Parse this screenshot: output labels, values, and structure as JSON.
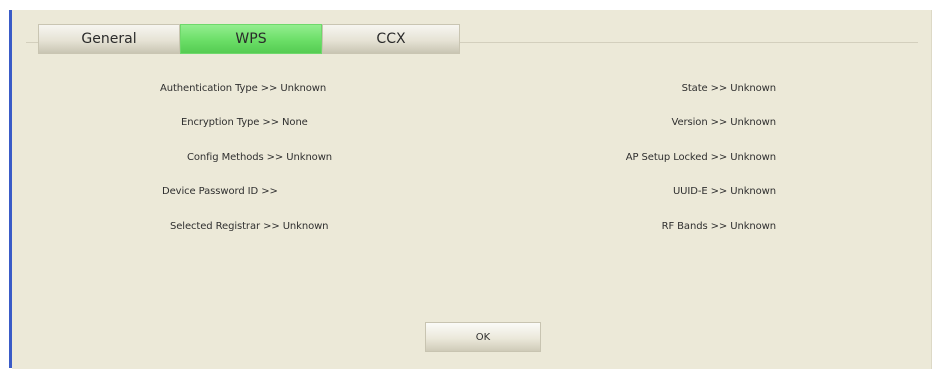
{
  "tabs": [
    {
      "label": "General",
      "active": false
    },
    {
      "label": "WPS",
      "active": true
    },
    {
      "label": "CCX",
      "active": false
    }
  ],
  "left_fields": [
    {
      "label": "Authentication Type >> Unknown"
    },
    {
      "label": "Encryption Type >> None"
    },
    {
      "label": "Config Methods >> Unknown"
    },
    {
      "label": "Device Password ID >>"
    },
    {
      "label": "Selected Registrar >> Unknown"
    }
  ],
  "right_fields": [
    {
      "label": "State >> Unknown"
    },
    {
      "label": "Version >> Unknown"
    },
    {
      "label": "AP Setup Locked >> Unknown"
    },
    {
      "label": "UUID-E >> Unknown"
    },
    {
      "label": "RF Bands >> Unknown"
    }
  ],
  "ok_button": {
    "label": "OK"
  },
  "colors": {
    "active_tab": "#6bde67",
    "panel_background": "#ece9d8",
    "left_edge": "#3a5bc7"
  }
}
